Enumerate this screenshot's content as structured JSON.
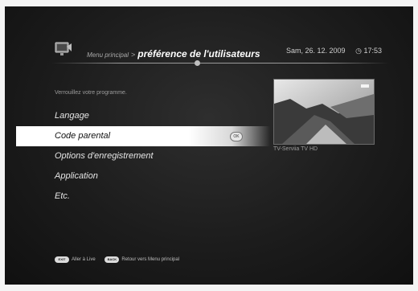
{
  "header": {
    "breadcrumb_root": "Menu principal",
    "breadcrumb_sep": ">",
    "title": "préférence de l'utilisateurs",
    "date": "Sam, 26. 12. 2009",
    "clock_icon": "clock-icon",
    "time": "17:53"
  },
  "subtitle": "Verrouillez votre programme.",
  "menu": {
    "items": [
      {
        "label": "Langage"
      },
      {
        "label": "Code parental",
        "selected": true
      },
      {
        "label": "Options d'enregistrement"
      },
      {
        "label": "Application"
      },
      {
        "label": "Etc."
      }
    ],
    "ok_label": "OK"
  },
  "preview": {
    "channel": "TV-Serviia TV HD"
  },
  "footer": {
    "exit_key": "EXIT",
    "exit_text": "Aller à Live",
    "back_key": "BACK",
    "back_text": "Retour vers Menu principal"
  }
}
